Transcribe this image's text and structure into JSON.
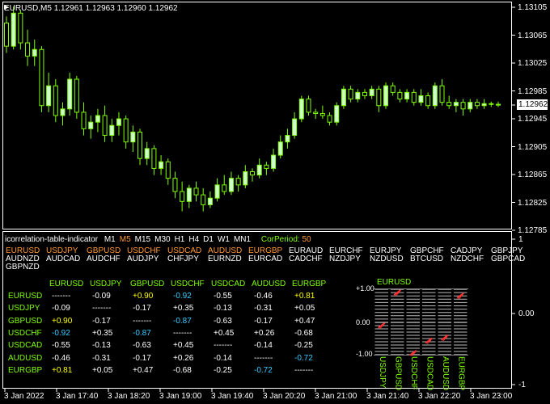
{
  "colors": {
    "background": "#000000",
    "frame": "#ffffff",
    "bull_candle": "#ccffcc",
    "bear_candle": "#000000",
    "candle_outline": "#7fff00",
    "axis_text": "#ffffff",
    "header_orange": "#ff9933",
    "header_green": "#80ff00",
    "label_green": "#80ff00",
    "positive_strong": "#ffff00",
    "negative_strong": "#33ccff",
    "neutral": "#ffffff",
    "bar_red": "#ff3333"
  },
  "chart_header": {
    "symbol_tf": "EURUSD,M5",
    "ohlc": "1.12961 1.12963 1.12960 1.12962"
  },
  "price_axis": {
    "labels": [
      "1.13105",
      "1.13065",
      "1.13025",
      "1.12985",
      "1.12945",
      "1.12905",
      "1.12865",
      "1.12825",
      "1.12785"
    ],
    "current_price": "1.12962"
  },
  "indicator_axis": {
    "labels": [
      "1",
      "0.00",
      "-1"
    ]
  },
  "time_axis": {
    "labels": [
      "3 Jan 2022",
      "3 Jan 17:40",
      "3 Jan 18:20",
      "3 Jan 19:00",
      "3 Jan 19:40",
      "3 Jan 20:20",
      "3 Jan 21:00",
      "3 Jan 21:40",
      "3 Jan 22:20",
      "3 Jan 23:00"
    ]
  },
  "chart_data": {
    "type": "candlestick",
    "ylim": [
      1.12775,
      1.13115
    ],
    "ohlc": [
      [
        1.13085,
        1.13095,
        1.1304,
        1.1305
      ],
      [
        1.1305,
        1.1311,
        1.13045,
        1.131
      ],
      [
        1.131,
        1.13105,
        1.13045,
        1.13055
      ],
      [
        1.13055,
        1.13075,
        1.1302,
        1.13035
      ],
      [
        1.13035,
        1.1306,
        1.1302,
        1.13045
      ],
      [
        1.13045,
        1.1305,
        1.1295,
        1.1296
      ],
      [
        1.1296,
        1.1301,
        1.1295,
        1.1299
      ],
      [
        1.1299,
        1.13,
        1.12935,
        1.12945
      ],
      [
        1.12945,
        1.12965,
        1.1293,
        1.12955
      ],
      [
        1.12955,
        1.1301,
        1.12945,
        1.13
      ],
      [
        1.13,
        1.13005,
        1.1294,
        1.1295
      ],
      [
        1.1295,
        1.12965,
        1.12915,
        1.12925
      ],
      [
        1.12925,
        1.12945,
        1.1291,
        1.12935
      ],
      [
        1.12935,
        1.12955,
        1.1292,
        1.12945
      ],
      [
        1.12945,
        1.1296,
        1.12905,
        1.12915
      ],
      [
        1.12915,
        1.1294,
        1.12905,
        1.1293
      ],
      [
        1.1293,
        1.1295,
        1.12915,
        1.1294
      ],
      [
        1.1294,
        1.12945,
        1.12895,
        1.12905
      ],
      [
        1.12905,
        1.1293,
        1.1289,
        1.1292
      ],
      [
        1.1292,
        1.12925,
        1.1287,
        1.1288
      ],
      [
        1.1288,
        1.12905,
        1.1287,
        1.12895
      ],
      [
        1.12895,
        1.129,
        1.12855,
        1.12865
      ],
      [
        1.12865,
        1.12885,
        1.12855,
        1.12875
      ],
      [
        1.12875,
        1.1288,
        1.1284,
        1.1285
      ],
      [
        1.1285,
        1.1286,
        1.1282,
        1.1283
      ],
      [
        1.1283,
        1.12845,
        1.128,
        1.12815
      ],
      [
        1.12815,
        1.1284,
        1.12805,
        1.12835
      ],
      [
        1.12835,
        1.12845,
        1.12815,
        1.12825
      ],
      [
        1.12825,
        1.12835,
        1.128,
        1.1281
      ],
      [
        1.1281,
        1.1283,
        1.12805,
        1.1282
      ],
      [
        1.1282,
        1.1285,
        1.12815,
        1.1284
      ],
      [
        1.1284,
        1.12855,
        1.12825,
        1.1283
      ],
      [
        1.1283,
        1.1286,
        1.12825,
        1.1285
      ],
      [
        1.1285,
        1.12855,
        1.1283,
        1.1284
      ],
      [
        1.1284,
        1.1287,
        1.12835,
        1.1286
      ],
      [
        1.1286,
        1.12865,
        1.12845,
        1.12855
      ],
      [
        1.12855,
        1.1288,
        1.1285,
        1.1287
      ],
      [
        1.1287,
        1.12875,
        1.12855,
        1.12865
      ],
      [
        1.12865,
        1.12895,
        1.1286,
        1.12885
      ],
      [
        1.12885,
        1.12915,
        1.1288,
        1.12905
      ],
      [
        1.12905,
        1.12925,
        1.12895,
        1.12915
      ],
      [
        1.12915,
        1.1295,
        1.1291,
        1.1294
      ],
      [
        1.1294,
        1.12975,
        1.12935,
        1.1297
      ],
      [
        1.1297,
        1.12975,
        1.12945,
        1.1295
      ],
      [
        1.1295,
        1.12955,
        1.1294,
        1.12948
      ],
      [
        1.12948,
        1.1296,
        1.1294,
        1.12945
      ],
      [
        1.12945,
        1.1295,
        1.1293,
        1.12935
      ],
      [
        1.12935,
        1.12965,
        1.1293,
        1.1296
      ],
      [
        1.1296,
        1.1299,
        1.12955,
        1.12985
      ],
      [
        1.12985,
        1.1299,
        1.12965,
        1.1297
      ],
      [
        1.1297,
        1.12985,
        1.12965,
        1.1298
      ],
      [
        1.1298,
        1.12985,
        1.1297,
        1.12975
      ],
      [
        1.12975,
        1.1299,
        1.1297,
        1.12985
      ],
      [
        1.12985,
        1.1299,
        1.1295,
        1.1296
      ],
      [
        1.1296,
        1.12995,
        1.12955,
        1.1299
      ],
      [
        1.1299,
        1.12995,
        1.12975,
        1.1298
      ],
      [
        1.1298,
        1.12985,
        1.12965,
        1.1297
      ],
      [
        1.1297,
        1.12985,
        1.12965,
        1.1298
      ],
      [
        1.1298,
        1.12985,
        1.1296,
        1.12965
      ],
      [
        1.12965,
        1.12985,
        1.1296,
        1.12975
      ],
      [
        1.12975,
        1.1298,
        1.12955,
        1.1296
      ],
      [
        1.1296,
        1.12995,
        1.12955,
        1.1299
      ],
      [
        1.1299,
        1.13,
        1.1296,
        1.12965
      ],
      [
        1.12965,
        1.12975,
        1.12955,
        1.1296
      ],
      [
        1.1296,
        1.1297,
        1.1295,
        1.12965
      ],
      [
        1.12965,
        1.1297,
        1.12945,
        1.12955
      ],
      [
        1.12955,
        1.1297,
        1.1295,
        1.12965
      ],
      [
        1.12965,
        1.1297,
        1.12955,
        1.1296
      ],
      [
        1.1296,
        1.1297,
        1.12955,
        1.12963
      ],
      [
        1.12963,
        1.12966,
        1.12958,
        1.12962
      ],
      [
        1.12962,
        1.12966,
        1.12958,
        1.12962
      ]
    ]
  },
  "indicator": {
    "name": "icorrelation-table-indicator",
    "timeframes": [
      {
        "label": "M1",
        "active": false
      },
      {
        "label": "M5",
        "active": true
      },
      {
        "label": "M15",
        "active": false
      },
      {
        "label": "M30",
        "active": false
      },
      {
        "label": "H1",
        "active": false
      },
      {
        "label": "H4",
        "active": false
      },
      {
        "label": "D1",
        "active": false
      },
      {
        "label": "W1",
        "active": false
      },
      {
        "label": "MN1",
        "active": false
      }
    ],
    "corperiod_label": "CorPeriod:",
    "corperiod_value": "50",
    "pairs_row1": [
      {
        "top": "EURUSD",
        "bottom": "AUDNZD",
        "orange": true
      },
      {
        "top": "USDJPY",
        "bottom": "AUDCAD",
        "orange": true
      },
      {
        "top": "GBPUSD",
        "bottom": "AUDCHF",
        "orange": true
      },
      {
        "top": "USDCHF",
        "bottom": "AUDJPY",
        "orange": true
      },
      {
        "top": "USDCAD",
        "bottom": "CHFJPY",
        "orange": true
      },
      {
        "top": "AUDUSD",
        "bottom": "EURNZD",
        "orange": true
      },
      {
        "top": "EURGBP",
        "bottom": "EURCAD",
        "orange": true
      },
      {
        "top": "EURAUD",
        "bottom": "CADCHF",
        "orange": false
      },
      {
        "top": "EURCHF",
        "bottom": "NZDJPY",
        "orange": false
      },
      {
        "top": "EURJPY",
        "bottom": "NZDUSD",
        "orange": false
      },
      {
        "top": "GBPCHF",
        "bottom": "BTCUSD",
        "orange": false
      },
      {
        "top": "CADJPY",
        "bottom": "NZDCHF",
        "orange": false
      },
      {
        "top": "GBPJPY",
        "bottom": "GBPCAD",
        "orange": false
      }
    ],
    "pairs_extra": "GBPNZD",
    "matrix": {
      "columns": [
        "EURUSD",
        "USDJPY",
        "GBPUSD",
        "USDCHF",
        "USDCAD",
        "AUDUSD",
        "EURGBP"
      ],
      "rows": [
        {
          "label": "EURUSD",
          "cells": [
            "-------",
            "-0.09",
            "+0.90",
            "-0.92",
            "-0.55",
            "-0.46",
            "+0.81"
          ]
        },
        {
          "label": "USDJPY",
          "cells": [
            "-0.09",
            "-------",
            "-0.17",
            "+0.35",
            "-0.13",
            "-0.31",
            "+0.05"
          ]
        },
        {
          "label": "GBPUSD",
          "cells": [
            "+0.90",
            "-0.17",
            "-------",
            "-0.87",
            "-0.63",
            "-0.17",
            "+0.47"
          ]
        },
        {
          "label": "USDCHF",
          "cells": [
            "-0.92",
            "+0.35",
            "-0.87",
            "-------",
            "+0.45",
            "+0.26",
            "-0.68"
          ]
        },
        {
          "label": "USDCAD",
          "cells": [
            "-0.55",
            "-0.13",
            "-0.63",
            "+0.45",
            "-------",
            "-0.14",
            "-0.25"
          ]
        },
        {
          "label": "AUDUSD",
          "cells": [
            "-0.46",
            "-0.31",
            "-0.17",
            "+0.26",
            "-0.14",
            "-------",
            "-0.72"
          ]
        },
        {
          "label": "EURGBP",
          "cells": [
            "+0.81",
            "+0.05",
            "+0.47",
            "-0.68",
            "-0.25",
            "-0.72",
            "-------"
          ]
        }
      ]
    },
    "bar_panel": {
      "title": "EURUSD",
      "y_labels": [
        "+1.00",
        "0.00",
        "-1.00"
      ],
      "bars": [
        {
          "label": "USDJPY",
          "value": -0.09
        },
        {
          "label": "GBPUSD",
          "value": 0.9
        },
        {
          "label": "USDCHF",
          "value": -0.92
        },
        {
          "label": "USDCAD",
          "value": -0.55
        },
        {
          "label": "AUDUSD",
          "value": -0.46
        },
        {
          "label": "EURGBP",
          "value": 0.81
        }
      ]
    }
  }
}
